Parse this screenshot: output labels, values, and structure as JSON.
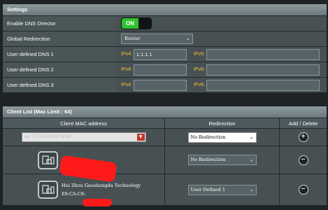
{
  "settings": {
    "header": "Settings",
    "dns_director": {
      "label": "Enable DNS Director",
      "toggle_on": "ON"
    },
    "global_redirection": {
      "label": "Global Redirection",
      "value": "Router"
    },
    "dns_rows": [
      {
        "label": "User defined DNS 1",
        "ipv4_label": "IPv4:",
        "ipv4": "1.1.1.1",
        "ipv6_label": "IPv6:",
        "ipv6": ""
      },
      {
        "label": "User defined DNS 2",
        "ipv4_label": "IPv4:",
        "ipv4": "",
        "ipv6_label": "IPv6:",
        "ipv6": ""
      },
      {
        "label": "User defined DNS 3",
        "ipv4_label": "IPv4:",
        "ipv4": "",
        "ipv6_label": "IPv6:",
        "ipv6": ""
      }
    ]
  },
  "client_list": {
    "header": "Client List (Max Limit : 64)",
    "columns": [
      "Client MAC address",
      "Redirection",
      "Add / Delete"
    ],
    "new_entry": {
      "mac_placeholder": "ex: 7C:10:C9:3E:58:80",
      "redirection": "No Redirection"
    },
    "clients": [
      {
        "name": "",
        "mac": "",
        "redirection": "No Redirection"
      },
      {
        "name": "Hui Zhou Gaoshengda Technology",
        "mac": "E8:CA:C8:",
        "redirection": "User Defined 1"
      }
    ]
  },
  "icons": {
    "caret": "chevron-down-icon",
    "add": "plus-circle-icon",
    "delete": "minus-circle-icon",
    "device": "device-icon"
  },
  "colors": {
    "toggle_on": "#2fc32f",
    "ip_label": "#f5c02d",
    "redaction": "#ff1a1a"
  }
}
